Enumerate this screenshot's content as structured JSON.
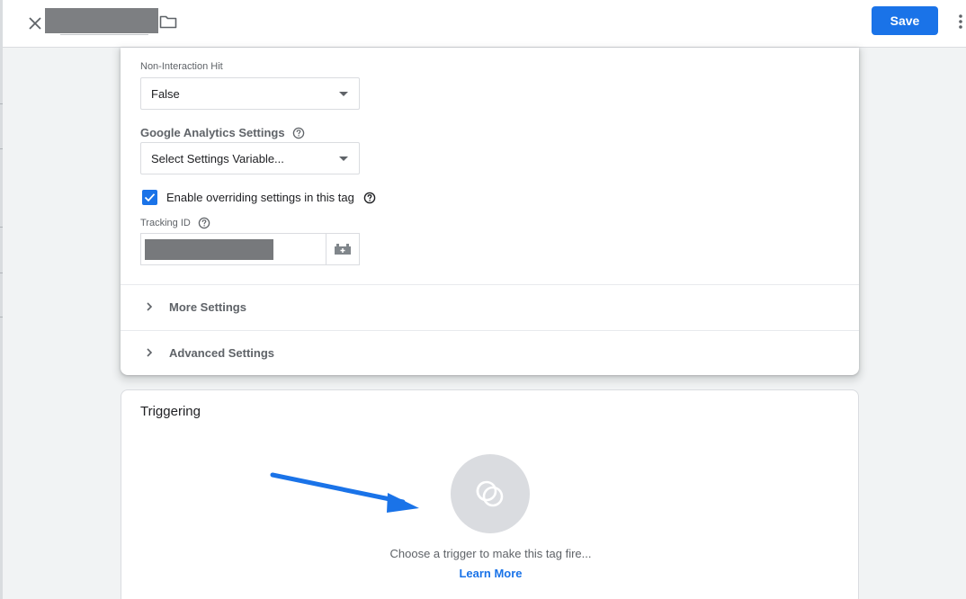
{
  "header": {
    "save_label": "Save"
  },
  "tag_config": {
    "non_interaction": {
      "label": "Non-Interaction Hit",
      "value": "False"
    },
    "ga_settings": {
      "label": "Google Analytics Settings",
      "value": "Select Settings Variable..."
    },
    "override": {
      "label": "Enable overriding settings in this tag",
      "checked": true
    },
    "tracking_id": {
      "label": "Tracking ID"
    },
    "more_settings": "More Settings",
    "advanced_settings": "Advanced Settings"
  },
  "triggering": {
    "title": "Triggering",
    "hint": "Choose a trigger to make this tag fire...",
    "learn_more": "Learn More"
  },
  "colors": {
    "accent": "#1a73e8",
    "annotation_arrow": "#1a73e8"
  }
}
